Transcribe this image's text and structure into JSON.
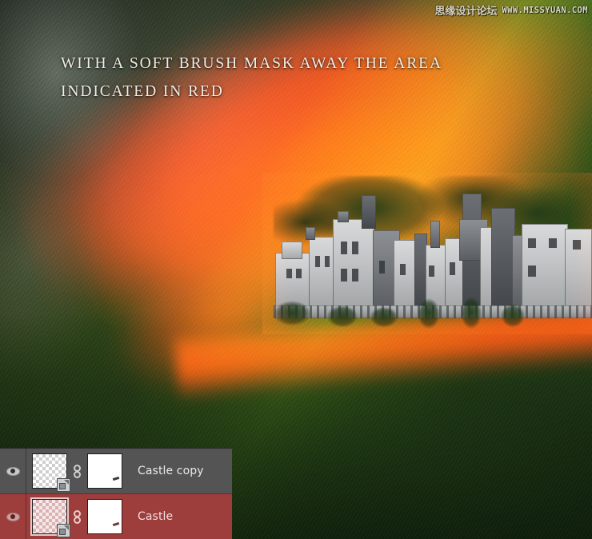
{
  "image": {
    "caption": "With a soft brush mask away the area\nindicated in red",
    "subject": "castle-photo-with-red-mask-overlay"
  },
  "watermark": {
    "site_name_cn": "思缘设计论坛",
    "site_url": "WWW.MISSYUAN.COM"
  },
  "layers_panel": {
    "rows": [
      {
        "name": "Castle copy",
        "visible_icon": "eye-icon",
        "link_icon": "link-icon",
        "layer_thumbnail": "transparent-checker-thumbnail",
        "mask_thumbnail": "white-layer-mask-thumbnail",
        "selected": false
      },
      {
        "name": "Castle",
        "visible_icon": "eye-icon",
        "link_icon": "link-icon",
        "layer_thumbnail": "transparent-checker-thumbnail",
        "mask_thumbnail": "white-layer-mask-thumbnail",
        "selected": true
      }
    ]
  },
  "colors": {
    "panel_bg": "#545454",
    "selected_row": "#9d3c3c",
    "mask_red": "#ff2800",
    "caption_text": "#f3efe6"
  }
}
